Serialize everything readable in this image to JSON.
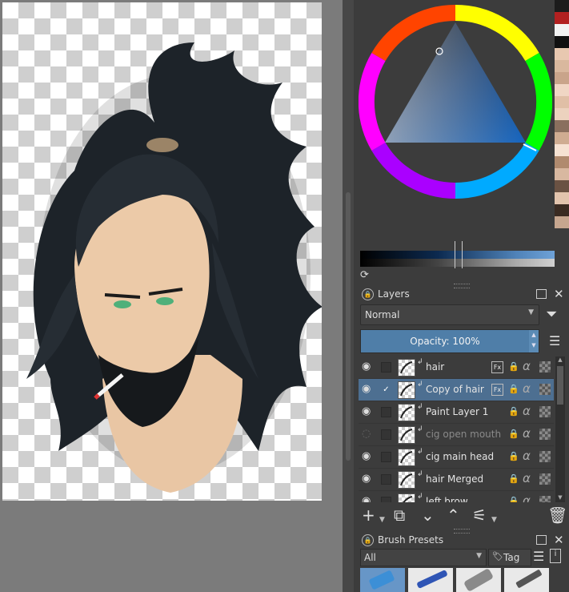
{
  "canvas": {
    "artwork": "character-illustration"
  },
  "color_selector": {
    "palette_colors": [
      "#1c1c1c",
      "#b22020",
      "#f2f2f2",
      "#101010",
      "#e8c8b0",
      "#d9b89e",
      "#c9a48a",
      "#f0d6c4",
      "#e0bfa6",
      "#ecd2be",
      "#8a6f5e",
      "#cfac91",
      "#f6e2d2",
      "#b08a6e",
      "#d8b8a0",
      "#6a5243",
      "#e2c4ad",
      "#3a2b22",
      "#c6a68f"
    ],
    "hue_accent": "#1565c0"
  },
  "layers_docker": {
    "title": "Layers",
    "blend_mode": "Normal",
    "opacity_label": "Opacity:  100%",
    "layers": [
      {
        "name": "hair",
        "visible": true,
        "selected": false,
        "has_fx": true,
        "locked": true
      },
      {
        "name": "Copy of hair",
        "visible": true,
        "selected": true,
        "has_fx": true,
        "locked": true
      },
      {
        "name": "Paint Layer 1",
        "visible": true,
        "selected": false,
        "has_fx": false,
        "locked": true
      },
      {
        "name": "cig open mouth",
        "visible": false,
        "selected": false,
        "has_fx": false,
        "locked": true
      },
      {
        "name": "cig main head",
        "visible": true,
        "selected": false,
        "has_fx": false,
        "locked": true
      },
      {
        "name": "hair Merged",
        "visible": true,
        "selected": false,
        "has_fx": false,
        "locked": true
      },
      {
        "name": "left brow",
        "visible": true,
        "selected": false,
        "has_fx": false,
        "locked": true
      }
    ],
    "toolbar_icons": [
      "add-layer-icon",
      "duplicate-layer-icon",
      "move-down-icon",
      "move-up-icon",
      "layer-properties-icon",
      "delete-layer-icon"
    ]
  },
  "brush_presets": {
    "title": "Brush Presets",
    "filter_value": "All",
    "tag_label": "Tag"
  }
}
